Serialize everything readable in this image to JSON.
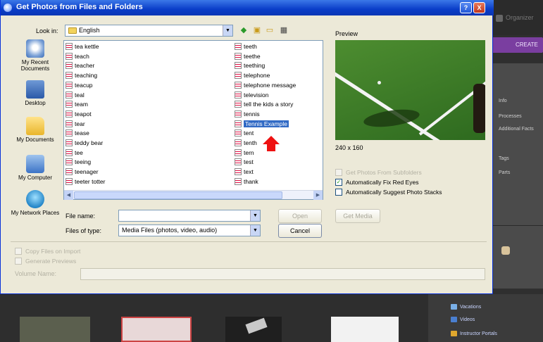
{
  "dialog": {
    "title": "Get Photos from Files and Folders",
    "help_button": "?",
    "close_button": "X",
    "look_in_label": "Look in:",
    "look_in_value": "English",
    "places": [
      {
        "label": "My Recent Documents"
      },
      {
        "label": "Desktop"
      },
      {
        "label": "My Documents"
      },
      {
        "label": "My Computer"
      },
      {
        "label": "My Network Places"
      }
    ],
    "files_col1": [
      "tea kettle",
      "teach",
      "teacher",
      "teaching",
      "teacup",
      "teal",
      "team",
      "teapot",
      "tear",
      "tease",
      "teddy bear",
      "tee",
      "teeing",
      "teenager",
      "teeter totter"
    ],
    "files_col2": [
      "teeth",
      "teethe",
      "teething",
      "telephone",
      "telephone message",
      "television",
      "tell the kids a story",
      "tennis",
      "Tennis Example",
      "tent",
      "tenth",
      "tern",
      "test",
      "text",
      "thank"
    ],
    "selected_file": "Tennis Example",
    "file_name_label": "File name:",
    "file_name_value": "",
    "files_of_type_label": "Files of type:",
    "files_of_type_value": "Media Files (photos, video, audio)",
    "open_button": "Open",
    "cancel_button": "Cancel",
    "get_media_button": "Get Media",
    "preview_label": "Preview",
    "preview_size": "240 x 160",
    "options": [
      {
        "label": "Get Photos From Subfolders",
        "checked": false,
        "enabled": false
      },
      {
        "label": "Automatically Fix Red Eyes",
        "checked": true,
        "enabled": true
      },
      {
        "label": "Automatically Suggest Photo Stacks",
        "checked": false,
        "enabled": true
      }
    ],
    "copy_option": {
      "label": "Copy Files on Import",
      "checked": false,
      "enabled": false
    },
    "generate_option": {
      "label": "Generate Previews",
      "checked": false,
      "enabled": false
    },
    "volume_name_label": "Volume Name:",
    "volume_name_value": ""
  },
  "background": {
    "brand": "Organizer",
    "create_tab": "CREATE",
    "panel_items": [
      "Info",
      "Processes",
      "Additional Facts",
      "Tags",
      "Parts"
    ],
    "tree_items": [
      "Vacations",
      "Videos",
      "Instructor Portals"
    ]
  },
  "colors": {
    "titlebar": "#0a3dc8",
    "selection": "#316ac5",
    "dialog_bg": "#ece9d8",
    "annotation_arrow": "#e11111",
    "create_tab": "#7a3ea0"
  }
}
